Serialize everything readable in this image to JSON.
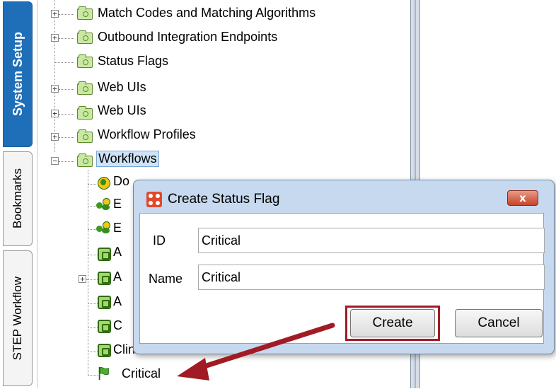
{
  "tabs": [
    {
      "label": "System Setup",
      "active": true
    },
    {
      "label": "Bookmarks",
      "active": false
    },
    {
      "label": "STEP Workflow",
      "active": false
    }
  ],
  "tree": {
    "items": [
      {
        "label": "Match Codes and Matching Algorithms",
        "expander": "+"
      },
      {
        "label": "Outbound Integration Endpoints",
        "expander": "+"
      },
      {
        "label": "Status Flags",
        "expander": ""
      },
      {
        "label": "Web UIs",
        "expander": "+"
      },
      {
        "label": "Web UIs",
        "expander": "+"
      },
      {
        "label": "Workflow Profiles",
        "expander": "+"
      },
      {
        "label": "Workflows",
        "expander": "−",
        "selected": true
      }
    ],
    "children": [
      {
        "label": "Do",
        "icon": "workflow-question-icon"
      },
      {
        "label": "E",
        "icon": "workflow-people-icon"
      },
      {
        "label": "E",
        "icon": "workflow-people-icon"
      },
      {
        "label": "A",
        "icon": "workflow-icon"
      },
      {
        "label": "A",
        "icon": "workflow-icon",
        "expander": "+"
      },
      {
        "label": "A",
        "icon": "workflow-icon"
      },
      {
        "label": "C",
        "icon": "workflow-icon"
      },
      {
        "label": "Clinical Review S",
        "icon": "workflow-icon"
      },
      {
        "label": "Critical",
        "icon": "status-flag-icon"
      }
    ]
  },
  "dialog": {
    "title": "Create Status Flag",
    "close_label": "x",
    "id_label": "ID",
    "id_value": "Critical",
    "name_label": "Name",
    "name_value": "Critical",
    "create_label": "Create",
    "cancel_label": "Cancel"
  },
  "colors": {
    "active_tab": "#1f6fb8",
    "highlight": "#a11b24",
    "arrow": "#a11b24",
    "dialog_frame": "#c6d9ef"
  }
}
